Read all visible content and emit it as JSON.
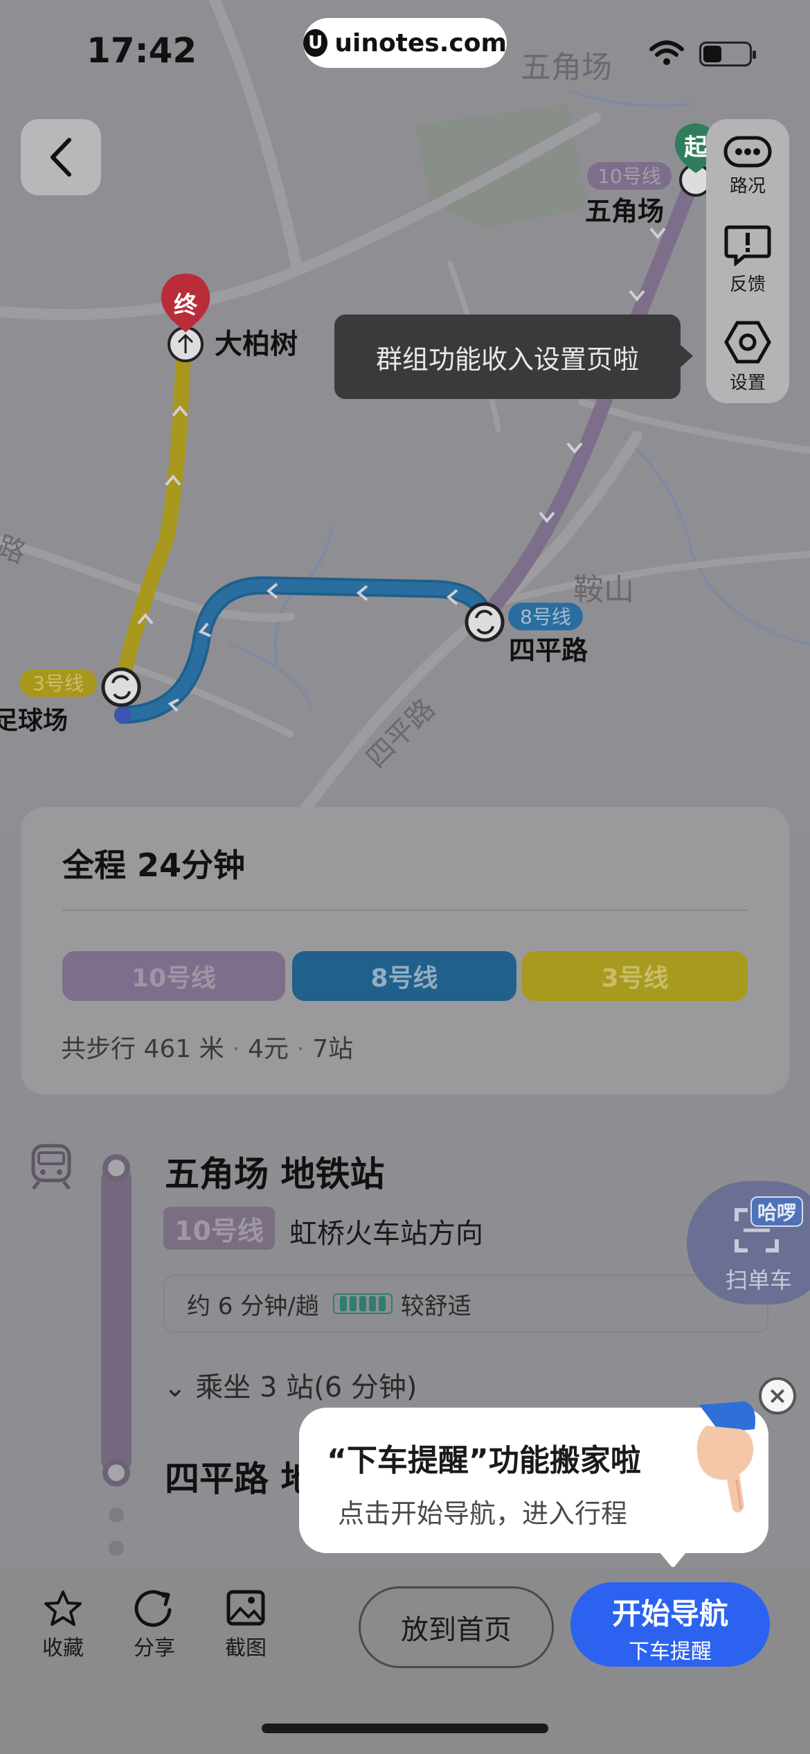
{
  "status_bar": {
    "time": "17:42",
    "site_label": "uinotes.com"
  },
  "map": {
    "labels": {
      "district_top": "五角场",
      "district_right": "鞍山",
      "road_left": "路",
      "road_siping": "四平路"
    },
    "stations": {
      "start_name": "五角场",
      "start_line": "10号线",
      "end_name": "大柏树",
      "transfer1_name": "四平路",
      "transfer1_line": "8号线",
      "transfer2_name": "虹口足球场",
      "transfer2_line": "3号线"
    },
    "markers": {
      "start": "起",
      "end": "终"
    },
    "colors": {
      "line10": "#7d6f8b",
      "line8": "#1f5f8c",
      "line3": "#a8971d"
    }
  },
  "side_tools": [
    {
      "label": "路况",
      "icon": "traffic-icon"
    },
    {
      "label": "反馈",
      "icon": "feedback-icon"
    },
    {
      "label": "设置",
      "icon": "settings-icon"
    }
  ],
  "tooltip": "群组功能收入设置页啦",
  "summary": {
    "title": "全程  24分钟",
    "lines": [
      {
        "name": "10号线",
        "color": "#7d6f8b",
        "text_color": "#9e95a6"
      },
      {
        "name": "8号线",
        "color": "#20608b",
        "text_color": "#94adc0"
      },
      {
        "name": "3号线",
        "color": "#a79a1f",
        "text_color": "#c8bd6a"
      }
    ],
    "walk": "共步行 461 米",
    "price": "4元",
    "stops": "7站"
  },
  "route": {
    "station1": "五角场 地铁站",
    "line_tag": "10号线",
    "direction": "虹桥火车站方向",
    "frequency": "约 6 分钟/趟",
    "comfort": "较舒适",
    "ride": "乘坐 3 站(6 分钟)",
    "station2": "四平路 地"
  },
  "scan": {
    "label": "扫单车",
    "badge": "哈啰"
  },
  "popup": {
    "title": "“下车提醒”功能搬家啦",
    "subtitle": "点击开始导航，进入行程"
  },
  "bottom_bar": {
    "favorite": "收藏",
    "share": "分享",
    "screenshot": "截图",
    "home": "放到首页",
    "nav_main": "开始导航",
    "nav_sub": "下车提醒"
  }
}
